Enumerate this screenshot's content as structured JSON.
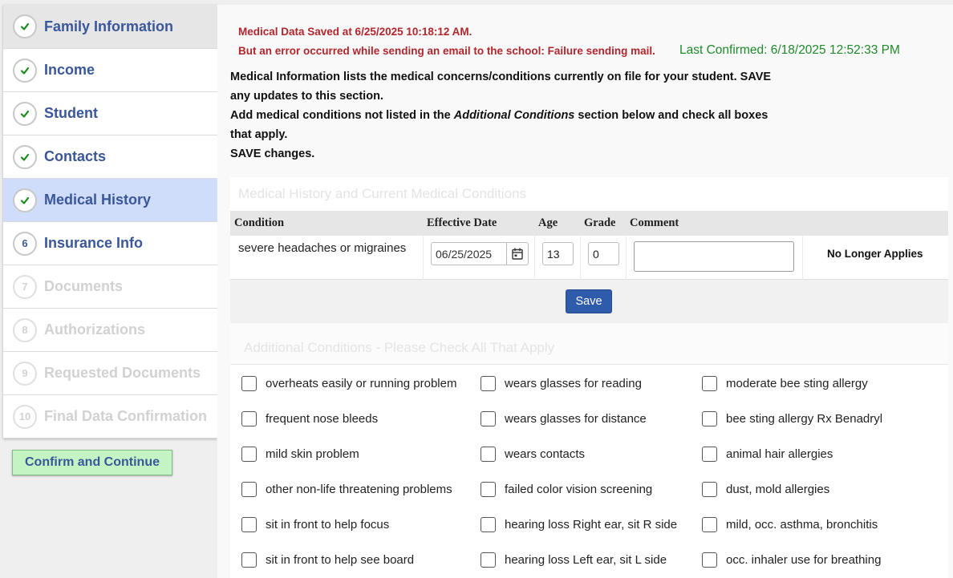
{
  "sidebar": {
    "steps": [
      {
        "marker": "✔",
        "label": "Family Information",
        "state": "complete-first"
      },
      {
        "marker": "✔",
        "label": "Income",
        "state": "complete"
      },
      {
        "marker": "✔",
        "label": "Student",
        "state": "complete"
      },
      {
        "marker": "✔",
        "label": "Contacts",
        "state": "complete"
      },
      {
        "marker": "✔",
        "label": "Medical History",
        "state": "active"
      },
      {
        "marker": "6",
        "label": "Insurance Info",
        "state": "enabled"
      },
      {
        "marker": "7",
        "label": "Documents",
        "state": "disabled"
      },
      {
        "marker": "8",
        "label": "Authorizations",
        "state": "disabled"
      },
      {
        "marker": "9",
        "label": "Requested Documents",
        "state": "disabled"
      },
      {
        "marker": "10",
        "label": "Final Data Confirmation",
        "state": "disabled"
      }
    ],
    "confirm_button": "Confirm and Continue"
  },
  "messages": {
    "saved": "Medical Data Saved at 6/25/2025 10:18:12 AM.",
    "error": "But an error occurred while sending an email to the school: Failure sending mail.",
    "last_confirmed": "Last Confirmed: 6/18/2025 12:52:33 PM"
  },
  "instructions": {
    "line1": "Medical Information lists the medical concerns/conditions currently on file for your student. SAVE any updates to this section.",
    "line2_pre": "Add medical conditions not listed in the ",
    "line2_em": "Additional Conditions",
    "line2_post": " section below and check all boxes that apply.",
    "line3": "SAVE changes."
  },
  "medical_section": {
    "title": "Medical History and Current Medical Conditions",
    "columns": {
      "condition": "Condition",
      "effective_date": "Effective Date",
      "age": "Age",
      "grade": "Grade",
      "comment": "Comment"
    },
    "row": {
      "condition": "severe headaches or migraines",
      "effective_date": "06/25/2025",
      "age": "13",
      "grade": "0",
      "comment": "",
      "status": "No Longer Applies"
    },
    "save_label": "Save"
  },
  "additional": {
    "title": "Additional Conditions - Please Check All That Apply",
    "columns": [
      [
        "overheats easily or running problem",
        "frequent nose bleeds",
        "mild skin problem",
        "other non-life threatening problems",
        "sit in front to help focus",
        "sit in front to help see board"
      ],
      [
        "wears glasses for reading",
        "wears glasses for distance",
        "wears contacts",
        "failed color vision screening",
        "hearing loss Right ear, sit R side",
        "hearing loss Left ear, sit L side"
      ],
      [
        "moderate bee sting allergy",
        "bee sting allergy Rx Benadryl",
        "animal hair allergies",
        "dust, mold allergies",
        "mild, occ. asthma, bronchitis",
        "occ. inhaler use for breathing"
      ]
    ]
  },
  "colors": {
    "accent_blue": "#3a5799",
    "active_step_bg": "#cfdcfa",
    "error_red": "#b0262c",
    "confirmed_green": "#1e8a2a",
    "save_button": "#2f5bab",
    "confirm_button_bg": "#c4f4c4"
  }
}
